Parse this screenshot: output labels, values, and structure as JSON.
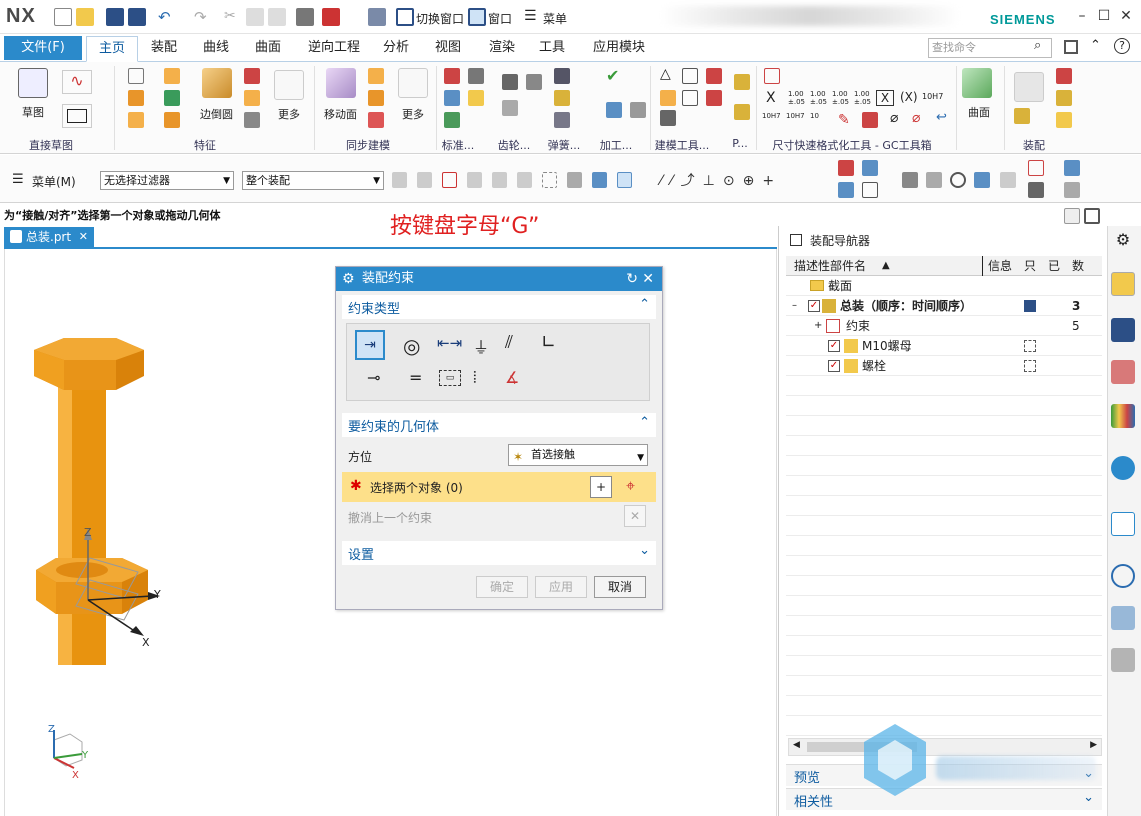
{
  "app": {
    "logo": "NX",
    "brand": "SIEMENS"
  },
  "quick_access": {
    "switch_window": "切换窗口",
    "window": "窗口",
    "menu": "菜单"
  },
  "menu_tabs": {
    "file": "文件(F)",
    "items": [
      "主页",
      "装配",
      "曲线",
      "曲面",
      "逆向工程",
      "分析",
      "视图",
      "渲染",
      "工具",
      "应用模块"
    ]
  },
  "search": {
    "placeholder": "查找命令"
  },
  "ribbon": {
    "sketch_label": "草图",
    "direct_sketch_group": "直接草图",
    "edge_blend_label": "边倒圆",
    "more_label_1": "更多",
    "feature_group": "特征",
    "move_face_label": "移动面",
    "more_label_2": "更多",
    "sync_group": "同步建模",
    "standard_group": "标准...",
    "gear_group": "齿轮...",
    "spring_group": "弹簧...",
    "machining_group": "加工...",
    "modeling_tools_group": "建模工具...",
    "p_group": "P...",
    "gc_group": "尺寸快速格式化工具 - GC工具箱",
    "surface_label": "曲面",
    "assembly_group": "装配",
    "tol_labels": [
      "1.00\n±.05",
      "1.00\n±.05",
      "1.00\n±.05",
      "1.00\n±.05"
    ],
    "x_label": "X",
    "paren_x_label": "(X)",
    "h7_label": "10H7",
    "h7_labels": [
      "10H7",
      "10H7",
      "10",
      "10H7"
    ]
  },
  "selbar": {
    "menu": "菜单(M)",
    "filter": "无选择过滤器",
    "scope": "整个装配"
  },
  "cue": "为“接触/对齐”选择第一个对象或拖动几何体",
  "overlay_note": "按键盘字母“G”",
  "doc_tab": "总装.prt",
  "triad": {
    "z": "Z",
    "y": "Y",
    "x": "X"
  },
  "dialog": {
    "title": "装配约束",
    "constraint_type": "约束类型",
    "geometry": "要约束的几何体",
    "orientation_label": "方位",
    "orientation_value": "首选接触",
    "select_objects": "选择两个对象 (0)",
    "undo_last": "撤消上一个约束",
    "settings": "设置",
    "ok": "确定",
    "apply": "应用",
    "cancel": "取消"
  },
  "navigator": {
    "title": "装配导航器",
    "columns": [
      "描述性部件名",
      "信息",
      "只",
      "已",
      "数"
    ],
    "rows": [
      {
        "name": "截面",
        "count": ""
      },
      {
        "name": "总装（顺序：时间顺序）",
        "count": "3"
      },
      {
        "name": "约束",
        "count": "5"
      },
      {
        "name": "M10螺母",
        "count": ""
      },
      {
        "name": "螺栓",
        "count": ""
      }
    ],
    "preview": "预览",
    "dependencies": "相关性"
  },
  "colors": {
    "accent": "#2b8acb",
    "part": "#f0a020",
    "warn_field": "#fde08a",
    "siemens": "#009999"
  }
}
